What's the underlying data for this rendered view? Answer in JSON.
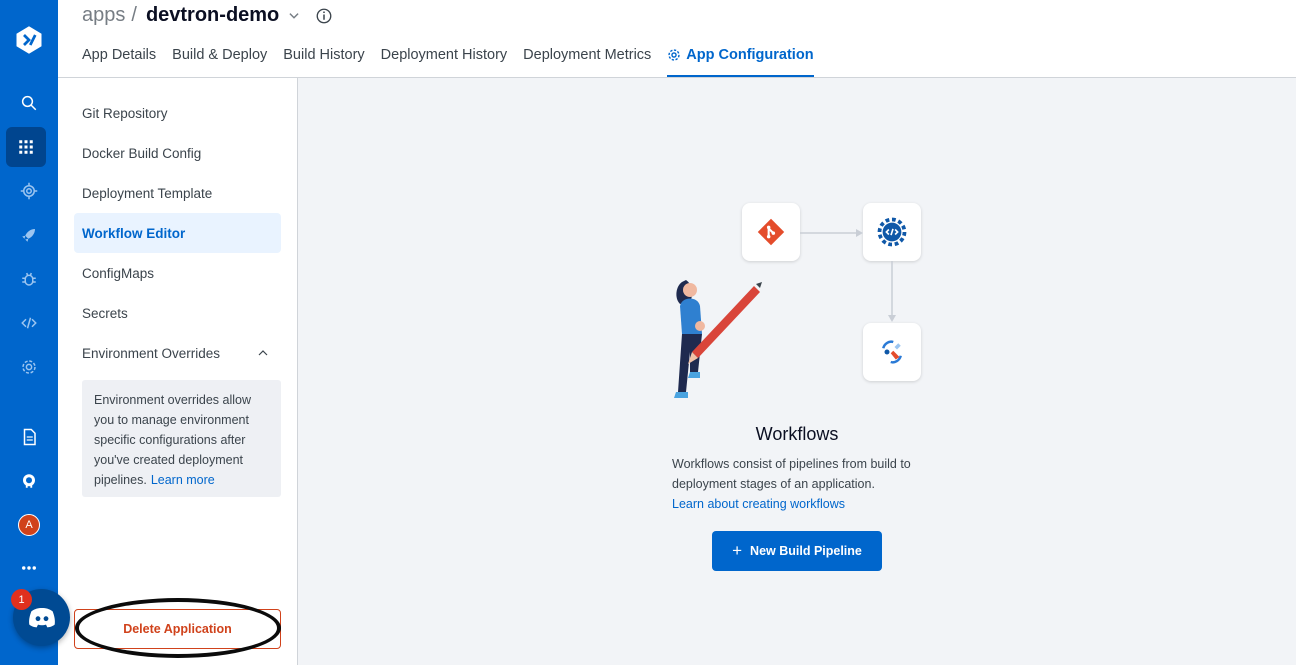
{
  "breadcrumb": {
    "root": "apps",
    "separator": "/",
    "app_name": "devtron-demo"
  },
  "tabs": [
    {
      "label": "App Details"
    },
    {
      "label": "Build & Deploy"
    },
    {
      "label": "Build History"
    },
    {
      "label": "Deployment History"
    },
    {
      "label": "Deployment Metrics"
    },
    {
      "label": "App Configuration",
      "active": true
    }
  ],
  "rail": {
    "icons": [
      "devtron-logo-icon",
      "search-icon",
      "apps-grid-icon",
      "global-config-icon",
      "deploy-rocket-icon",
      "security-bug-icon",
      "code-icon",
      "settings-icon",
      "docs-icon",
      "github-icon",
      "avatar",
      "more-icon"
    ],
    "avatar_initial": "A"
  },
  "nav": {
    "items": [
      {
        "label": "Git Repository"
      },
      {
        "label": "Docker Build Config"
      },
      {
        "label": "Deployment Template"
      },
      {
        "label": "Workflow Editor",
        "active": true
      },
      {
        "label": "ConfigMaps"
      },
      {
        "label": "Secrets"
      },
      {
        "label": "Environment Overrides"
      }
    ],
    "override_info": "Environment overrides allow you to manage environment specific configurations after you've created deployment pipelines.",
    "override_link": "Learn more",
    "delete_label": "Delete Application"
  },
  "main": {
    "title": "Workflows",
    "description": "Workflows consist of pipelines from build to deployment stages of an application.",
    "link": "Learn about creating workflows",
    "button_label": "New Build Pipeline"
  },
  "discord": {
    "badge_count": "1"
  },
  "colors": {
    "primary": "#0066cc",
    "rail": "#0066cc",
    "danger": "#d0421b",
    "active_bg": "#e9f3ff"
  }
}
